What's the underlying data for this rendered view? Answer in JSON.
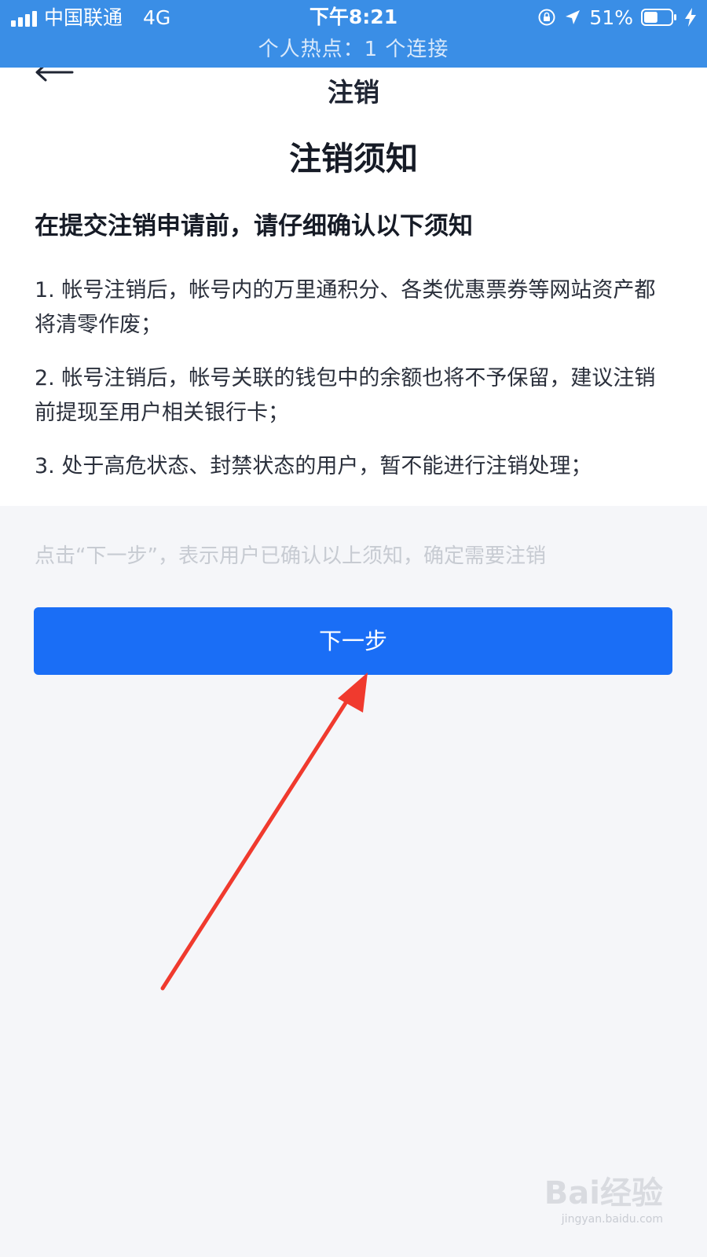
{
  "status_bar": {
    "carrier": "中国联通",
    "network": "4G",
    "time": "下午8:21",
    "battery": "51%",
    "battery_level": 0.51,
    "hotspot": "个人热点：1 个连接"
  },
  "nav": {
    "title": "注销"
  },
  "notice": {
    "title": "注销须知",
    "subtitle": "在提交注销申请前，请仔细确认以下须知",
    "items": [
      "1. 帐号注销后，帐号内的万里通积分、各类优惠票券等网站资产都将清零作废；",
      "2. 帐号注销后，帐号关联的钱包中的余额也将不予保留，建议注销前提现至用户相关银行卡；",
      "3. 处于高危状态、封禁状态的用户，暂不能进行注销处理；"
    ]
  },
  "confirm_text": "点击“下一步”，表示用户已确认以上须知，确定需要注销",
  "next_button": {
    "label": "下一步"
  },
  "watermark": {
    "logo": "Bai经验",
    "url": "jingyan.baidu.com"
  },
  "colors": {
    "status_bar": "#3a8ee6",
    "primary_button": "#1a6ef6",
    "annotation_arrow": "#f03a2e"
  }
}
